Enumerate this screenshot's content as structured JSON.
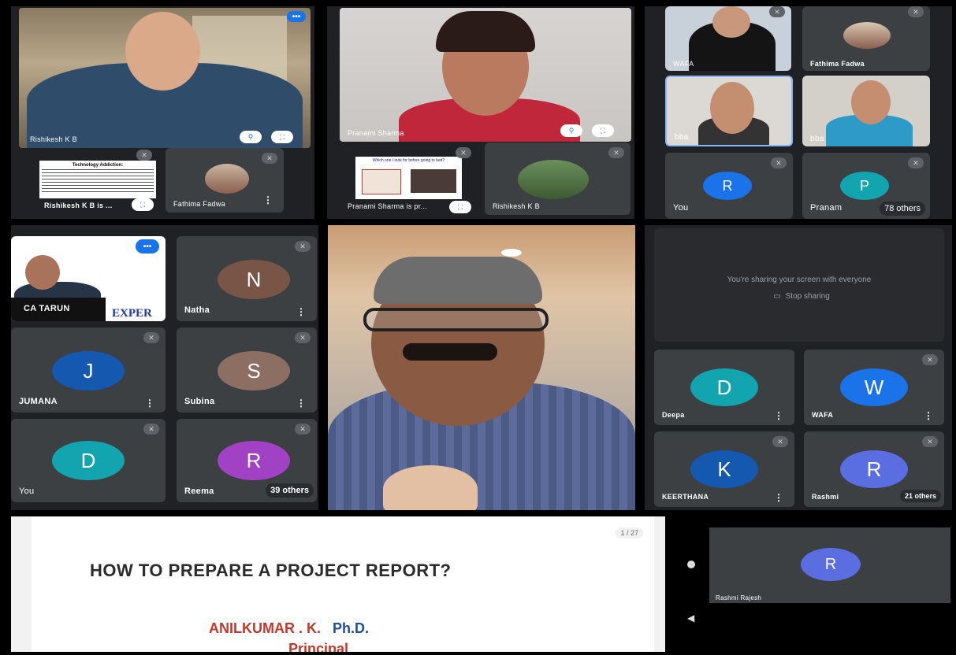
{
  "colors": {
    "background": "#000000",
    "tile": "#3c4043",
    "accent_blue": "#1a73e8",
    "title_red": "#c0392b",
    "title_blue": "#1f4e9c"
  },
  "panel1": {
    "main_speaker": "Rishikesh K B",
    "presenting_label": "Rishikesh K B is ...",
    "slide_title": "Technology Addiction:",
    "participant": "Fathima Fadwa"
  },
  "panel2": {
    "main_speaker": "Pranami Sharma",
    "presenting_label": "Pranami Sharma is pr...",
    "slide_title": "Which one I look for before going to bed?",
    "participant": "Rishikesh K B"
  },
  "panel3": {
    "tiles": [
      {
        "name": "WAFA"
      },
      {
        "name": "Fathima Fadwa"
      },
      {
        "name": "bba"
      },
      {
        "name": "bba"
      }
    ],
    "you_initial": "R",
    "you_label": "You",
    "other_initial": "P",
    "other_label": "Pranam",
    "others_count": "78 others"
  },
  "panel4": {
    "main_speaker": "CA TARUN",
    "logo_text": "EXPER",
    "tiles": [
      {
        "initial": "N",
        "name": "Natha",
        "color": "#795548"
      },
      {
        "initial": "J",
        "name": "JUMANA",
        "color": "#1558b0"
      },
      {
        "initial": "S",
        "name": "Subina",
        "color": "#8d6e63"
      },
      {
        "initial": "D",
        "name": "You",
        "color": "#12a4af"
      },
      {
        "initial": "R",
        "name": "Reema",
        "color": "#a142c4"
      }
    ],
    "others_count": "39 others"
  },
  "panel6": {
    "sharing_message": "You're sharing your screen with everyone",
    "stop_sharing_label": "Stop sharing",
    "tiles": [
      {
        "initial": "D",
        "name": "Deepa",
        "color": "#12a4af"
      },
      {
        "initial": "W",
        "name": "WAFA",
        "color": "#1a73e8"
      },
      {
        "initial": "K",
        "name": "KEERTHANA",
        "color": "#1558b0"
      },
      {
        "initial": "R",
        "name": "Rashmi",
        "color": "#5b6ee1"
      }
    ],
    "others_count": "21 others"
  },
  "slide": {
    "page_indicator": "1 / 27",
    "title": "HOW TO PREPARE A PROJECT REPORT?",
    "author": "ANILKUMAR . K.",
    "degree": "Ph.D.",
    "position": "Principal"
  },
  "mobile": {
    "initial": "R",
    "name": "Rashmi Rajesh"
  }
}
